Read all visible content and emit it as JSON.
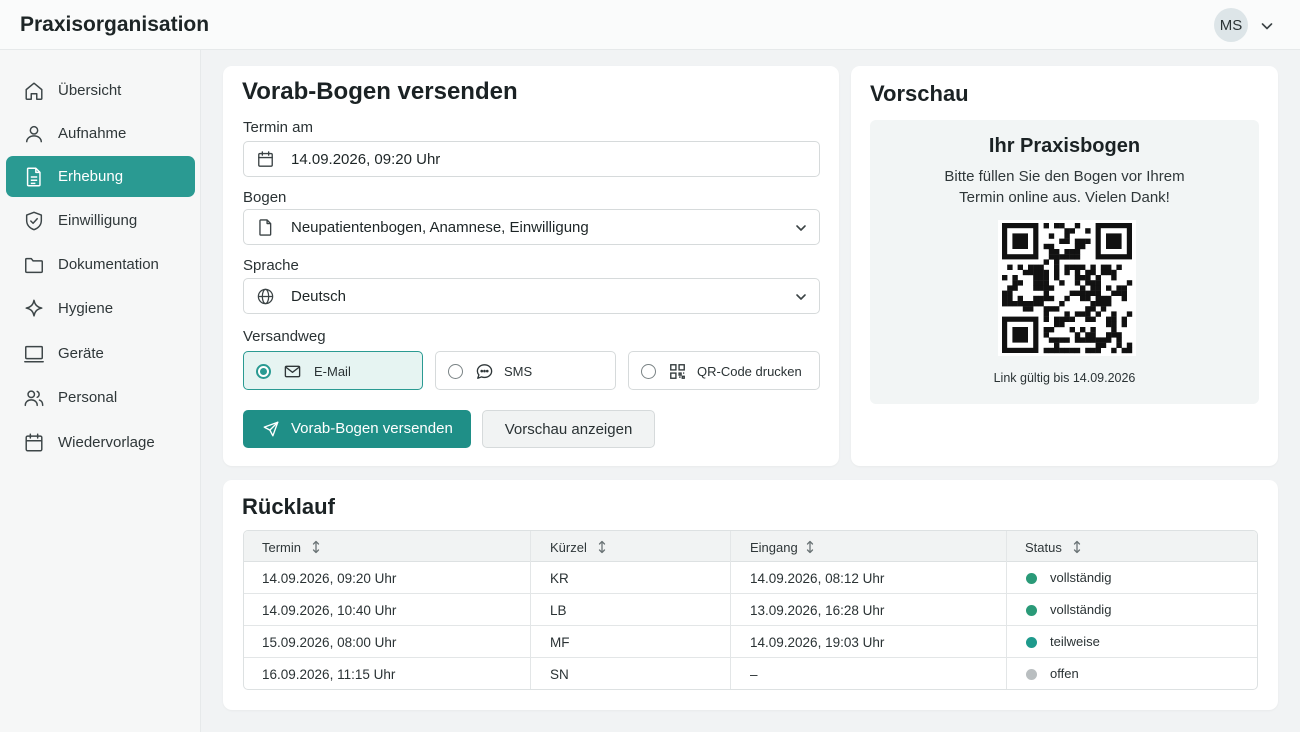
{
  "app": {
    "title": "Praxisorganisation",
    "user_initials": "MS"
  },
  "sidebar": {
    "items": [
      {
        "label": "Übersicht",
        "icon": "home-icon",
        "active": false
      },
      {
        "label": "Aufnahme",
        "icon": "user-icon",
        "active": false
      },
      {
        "label": "Erhebung",
        "icon": "document-icon",
        "active": true
      },
      {
        "label": "Einwilligung",
        "icon": "shield-icon",
        "active": false
      },
      {
        "label": "Dokumentation",
        "icon": "folder-icon",
        "active": false
      },
      {
        "label": "Hygiene",
        "icon": "sparkle-icon",
        "active": false
      },
      {
        "label": "Geräte",
        "icon": "monitor-icon",
        "active": false
      },
      {
        "label": "Personal",
        "icon": "users-icon",
        "active": false
      },
      {
        "label": "Wiedervorlage",
        "icon": "calendar-icon",
        "active": false
      }
    ]
  },
  "form": {
    "title": "Vorab-Bogen versenden",
    "termin_label": "Termin am",
    "termin_value": "14.09.2026, 09:20 Uhr",
    "bogen_label": "Bogen",
    "bogen_value": "Neupatientenbogen, Anamnese, Einwilligung",
    "sprache_label": "Sprache",
    "sprache_value": "Deutsch",
    "versandweg_label": "Versandweg",
    "options": [
      {
        "label": "E-Mail",
        "icon": "mail-icon",
        "selected": true
      },
      {
        "label": "SMS",
        "icon": "chat-icon",
        "selected": false
      },
      {
        "label": "QR-Code drucken",
        "icon": "qr-icon",
        "selected": false
      }
    ],
    "send_label": "Vorab-Bogen versenden",
    "preview_label": "Vorschau anzeigen"
  },
  "preview": {
    "title": "Vorschau",
    "heading": "Ihr Praxisbogen",
    "line1": "Bitte füllen Sie den Bogen vor Ihrem",
    "line2": "Termin online aus. Vielen Dank!",
    "footer": "Link gültig bis 14.09.2026"
  },
  "ruecklauf": {
    "title": "Rücklauf",
    "columns": [
      "Termin",
      "Kürzel",
      "Eingang",
      "Status"
    ],
    "rows": [
      {
        "termin": "14.09.2026, 09:20 Uhr",
        "kuerzel": "KR",
        "eingang": "14.09.2026, 08:12 Uhr",
        "status": "vollständig",
        "status_color": "#2a9a78"
      },
      {
        "termin": "14.09.2026, 10:40 Uhr",
        "kuerzel": "LB",
        "eingang": "13.09.2026, 16:28 Uhr",
        "status": "vollständig",
        "status_color": "#2a9a78"
      },
      {
        "termin": "15.09.2026, 08:00 Uhr",
        "kuerzel": "MF",
        "eingang": "14.09.2026, 19:03 Uhr",
        "status": "teilweise",
        "status_color": "#1e9a8c"
      },
      {
        "termin": "16.09.2026, 11:15 Uhr",
        "kuerzel": "SN",
        "eingang": "–",
        "status": "offen",
        "status_color": "#b9bec0"
      }
    ]
  },
  "colors": {
    "accent": "#2a9a92",
    "primary_button": "#1f8f87"
  }
}
